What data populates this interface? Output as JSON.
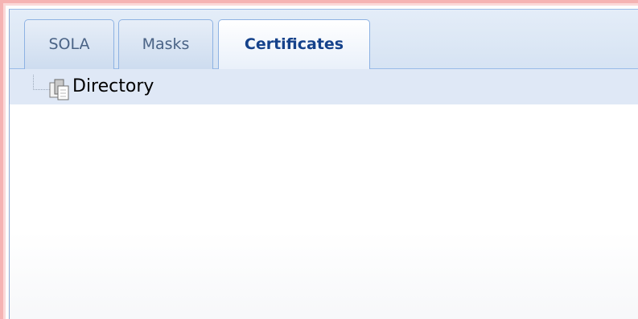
{
  "tabs": [
    {
      "label": "SOLA",
      "active": false
    },
    {
      "label": "Masks",
      "active": false
    },
    {
      "label": "Certificates",
      "active": true
    }
  ],
  "tree": {
    "root": {
      "label": "Directory",
      "icon": "folder-stack-icon"
    }
  },
  "colors": {
    "tab_border": "#8db2e3",
    "active_tab_text": "#15428b",
    "inactive_tab_text": "#4a6386",
    "selected_row": "#dfe8f6"
  }
}
